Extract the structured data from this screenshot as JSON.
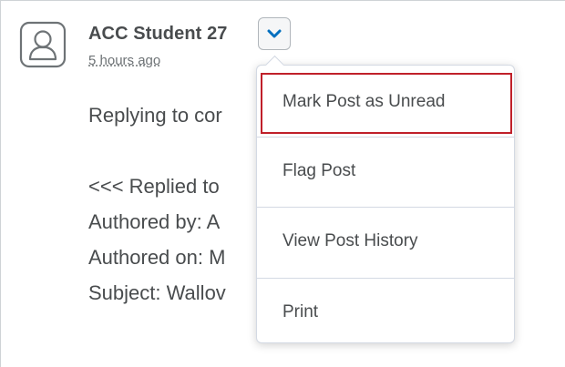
{
  "post": {
    "author": "ACC Student 27",
    "timestamp": "5 hours ago",
    "body_lines": [
      "Replying to cor",
      "<<< Replied to",
      "Authored by: A",
      "Authored on: M",
      "Subject: Wallov"
    ]
  },
  "icons": {
    "avatar": "user-placeholder-icon",
    "toggle": "chevron-down-icon"
  },
  "context_menu": {
    "items": [
      {
        "label": "Mark Post as Unread",
        "highlighted": true
      },
      {
        "label": "Flag Post"
      },
      {
        "label": "View Post History"
      },
      {
        "label": "Print"
      }
    ]
  },
  "colors": {
    "text": "#494c4e",
    "accent_blue": "#006fbf",
    "highlight_border": "#c0202a"
  }
}
